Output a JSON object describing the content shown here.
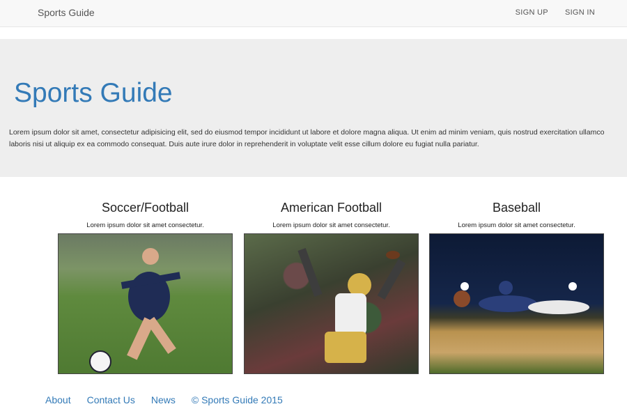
{
  "navbar": {
    "brand": "Sports Guide",
    "links": [
      "SIGN UP",
      "SIGN IN"
    ]
  },
  "hero": {
    "title": "Sports Guide",
    "text": "Lorem ipsum dolor sit amet, consectetur adipisicing elit, sed do eiusmod tempor incididunt ut labore et dolore magna aliqua. Ut enim ad minim veniam, quis nostrud exercitation ullamco laboris nisi ut aliquip ex ea commodo consequat. Duis aute irure dolor in reprehenderit in voluptate velit esse cillum dolore eu fugiat nulla pariatur."
  },
  "cards": [
    {
      "title": "Soccer/Football",
      "subtitle": "Lorem ipsum dolor sit amet consectetur."
    },
    {
      "title": "American Football",
      "subtitle": "Lorem ipsum dolor sit amet consectetur."
    },
    {
      "title": "Baseball",
      "subtitle": "Lorem ipsum dolor sit amet consectetur."
    }
  ],
  "footer": {
    "links": [
      "About",
      "Contact Us",
      "News"
    ],
    "copyright": "© Sports Guide 2015"
  },
  "colors": {
    "link": "#337ab7",
    "hero_bg": "#eeeeee"
  }
}
